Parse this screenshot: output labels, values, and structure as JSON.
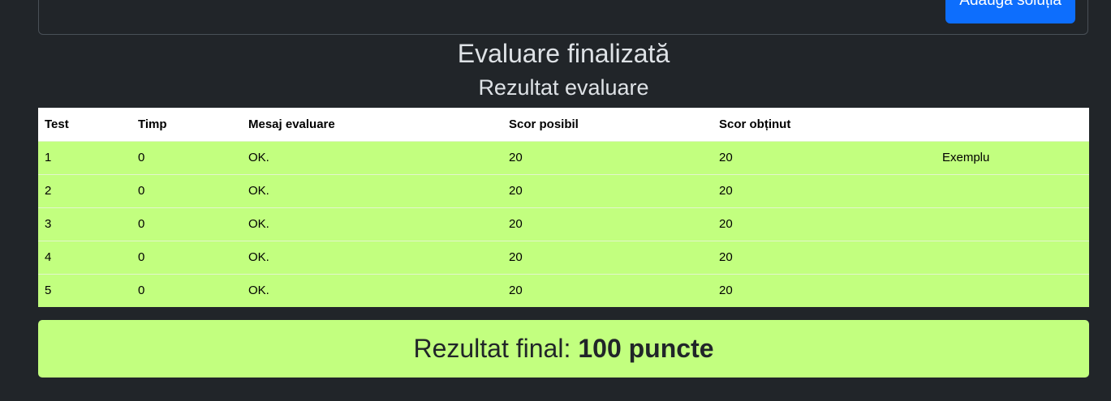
{
  "top_card": {
    "submit_label": "Adaugă soluția"
  },
  "header": {
    "title": "Evaluare finalizată",
    "subtitle": "Rezultat evaluare"
  },
  "table": {
    "columns": [
      "Test",
      "Timp",
      "Mesaj evaluare",
      "Scor posibil",
      "Scor obținut",
      ""
    ],
    "rows": [
      [
        "1",
        "0",
        "OK.",
        "20",
        "20",
        "Exemplu"
      ],
      [
        "2",
        "0",
        "OK.",
        "20",
        "20",
        ""
      ],
      [
        "3",
        "0",
        "OK.",
        "20",
        "20",
        ""
      ],
      [
        "4",
        "0",
        "OK.",
        "20",
        "20",
        ""
      ],
      [
        "5",
        "0",
        "OK.",
        "20",
        "20",
        ""
      ]
    ]
  },
  "final": {
    "label": "Rezultat final:",
    "value": "100 puncte"
  },
  "colors": {
    "background": "#212529",
    "success_row": "#c2ff7f",
    "primary_button": "#0d6efd"
  }
}
